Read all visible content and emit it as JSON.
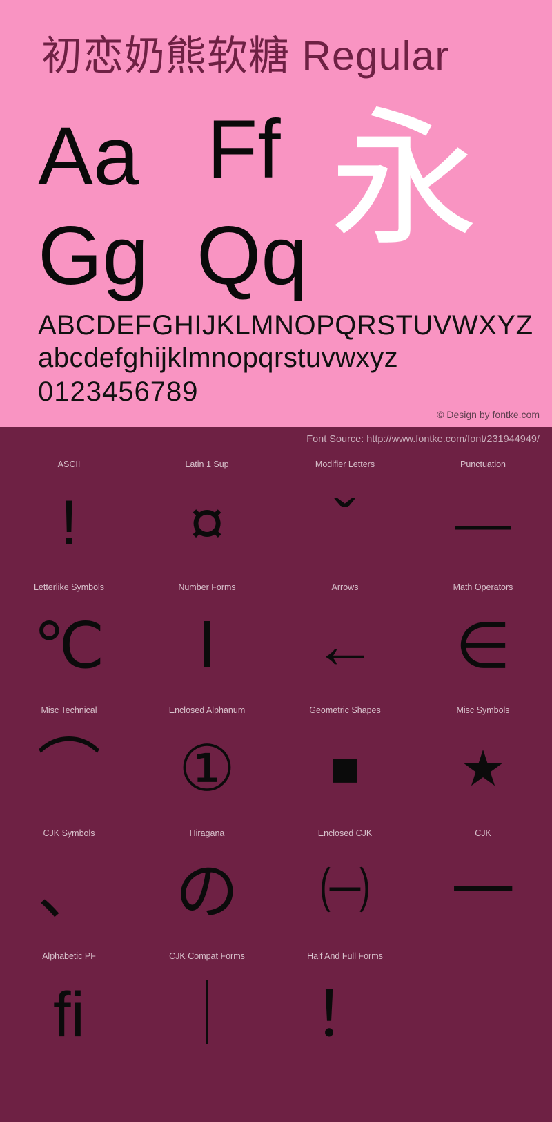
{
  "specimen": {
    "title_cjk": "初恋奶熊软糖",
    "title_style": "Regular",
    "title_full": "初恋奶熊软糖 Regular",
    "background_color": "#f994c2",
    "text_color": "#6e2144",
    "sample_glyph_color": "#0a0a0a",
    "cjk_sample_color": "#ffffff",
    "big_samples": [
      {
        "name": "sample-aa",
        "text": "Aa"
      },
      {
        "name": "sample-ff",
        "text": "Ff"
      },
      {
        "name": "sample-gg",
        "text": "Gg"
      },
      {
        "name": "sample-qq",
        "text": "Qq"
      },
      {
        "name": "sample-cjk",
        "text": "永"
      }
    ],
    "uppercase": "ABCDEFGHIJKLMNOPQRSTUVWXYZ",
    "lowercase": "abcdefghijklmnopqrstuvwxyz",
    "digits": "0123456789",
    "copyright": "© Design by fontke.com"
  },
  "grid_panel": {
    "background_color": "#6e2144",
    "label_color": "#d8c2cc",
    "glyph_color": "#0b0b0b",
    "font_source": "Font Source: http://www.fontke.com/font/231944949/",
    "blocks": [
      {
        "label": "ASCII",
        "glyph": "!",
        "glyph_name": "exclamation-mark"
      },
      {
        "label": "Latin 1 Sup",
        "glyph": "¤",
        "glyph_name": "currency-sign"
      },
      {
        "label": "Modifier Letters",
        "glyph": "ˇ",
        "glyph_name": "caron"
      },
      {
        "label": "Punctuation",
        "glyph": "—",
        "glyph_name": "em-dash"
      },
      {
        "label": "Letterlike Symbols",
        "glyph": "℃",
        "glyph_name": "degree-celsius"
      },
      {
        "label": "Number Forms",
        "glyph": "Ⅰ",
        "glyph_name": "roman-numeral-one"
      },
      {
        "label": "Arrows",
        "glyph": "←",
        "glyph_name": "leftwards-arrow"
      },
      {
        "label": "Math Operators",
        "glyph": "∈",
        "glyph_name": "element-of"
      },
      {
        "label": "Misc Technical",
        "glyph": "⌒",
        "glyph_name": "arc"
      },
      {
        "label": "Enclosed Alphanum",
        "glyph": "①",
        "glyph_name": "circled-digit-one"
      },
      {
        "label": "Geometric Shapes",
        "glyph": "■",
        "glyph_name": "black-square"
      },
      {
        "label": "Misc Symbols",
        "glyph": "★",
        "glyph_name": "black-star"
      },
      {
        "label": "CJK Symbols",
        "glyph": "、",
        "glyph_name": "ideographic-comma"
      },
      {
        "label": "Hiragana",
        "glyph": "の",
        "glyph_name": "hiragana-no"
      },
      {
        "label": "Enclosed CJK",
        "glyph": "㈠",
        "glyph_name": "parenthesized-ideograph-one"
      },
      {
        "label": "CJK",
        "glyph": "一",
        "glyph_name": "ideograph-one"
      },
      {
        "label": "Alphabetic PF",
        "glyph": "ﬁ",
        "glyph_name": "fi-ligature"
      },
      {
        "label": "CJK Compat Forms",
        "glyph": "｜",
        "glyph_name": "fullwidth-vertical-line"
      },
      {
        "label": "Half And Full Forms",
        "glyph": "！",
        "glyph_name": "fullwidth-exclamation-mark"
      }
    ]
  }
}
